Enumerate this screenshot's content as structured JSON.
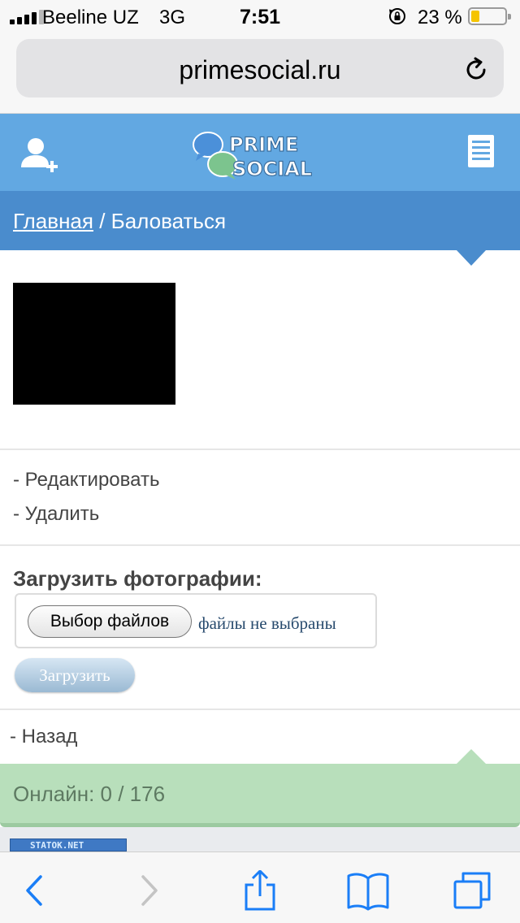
{
  "status_bar": {
    "carrier": "Beeline UZ",
    "network": "3G",
    "time": "7:51",
    "battery_percent": "23 %",
    "battery_level": 0.23,
    "battery_color": "#f5c400"
  },
  "browser": {
    "url": "primesocial.ru",
    "reload_icon": "reload-icon"
  },
  "site_header": {
    "logo_line1": "PRIME",
    "logo_line2": "SOCIAL",
    "add_user_icon": "add-user-icon",
    "menu_icon": "menu-icon",
    "color": "#62a8e2"
  },
  "breadcrumb": {
    "home": "Главная",
    "separator": " / ",
    "current": "Баловаться",
    "color": "#4a8ccd"
  },
  "actions": {
    "edit": "- Редактировать",
    "delete": "- Удалить"
  },
  "upload": {
    "title": "Загрузить фотографии:",
    "choose_files": "Выбор файлов",
    "no_files": "файлы не выбраны",
    "submit": "Загрузить"
  },
  "back_link": "- Назад",
  "online": {
    "text": "Онлайн: 0 / 176",
    "color": "#b8dfbb"
  },
  "counter_badge": "STATOK.NET",
  "safari_toolbar": {
    "icons": [
      "back-icon",
      "forward-icon",
      "share-icon",
      "bookmarks-icon",
      "tabs-icon"
    ],
    "accent": "#1a7ef7"
  }
}
